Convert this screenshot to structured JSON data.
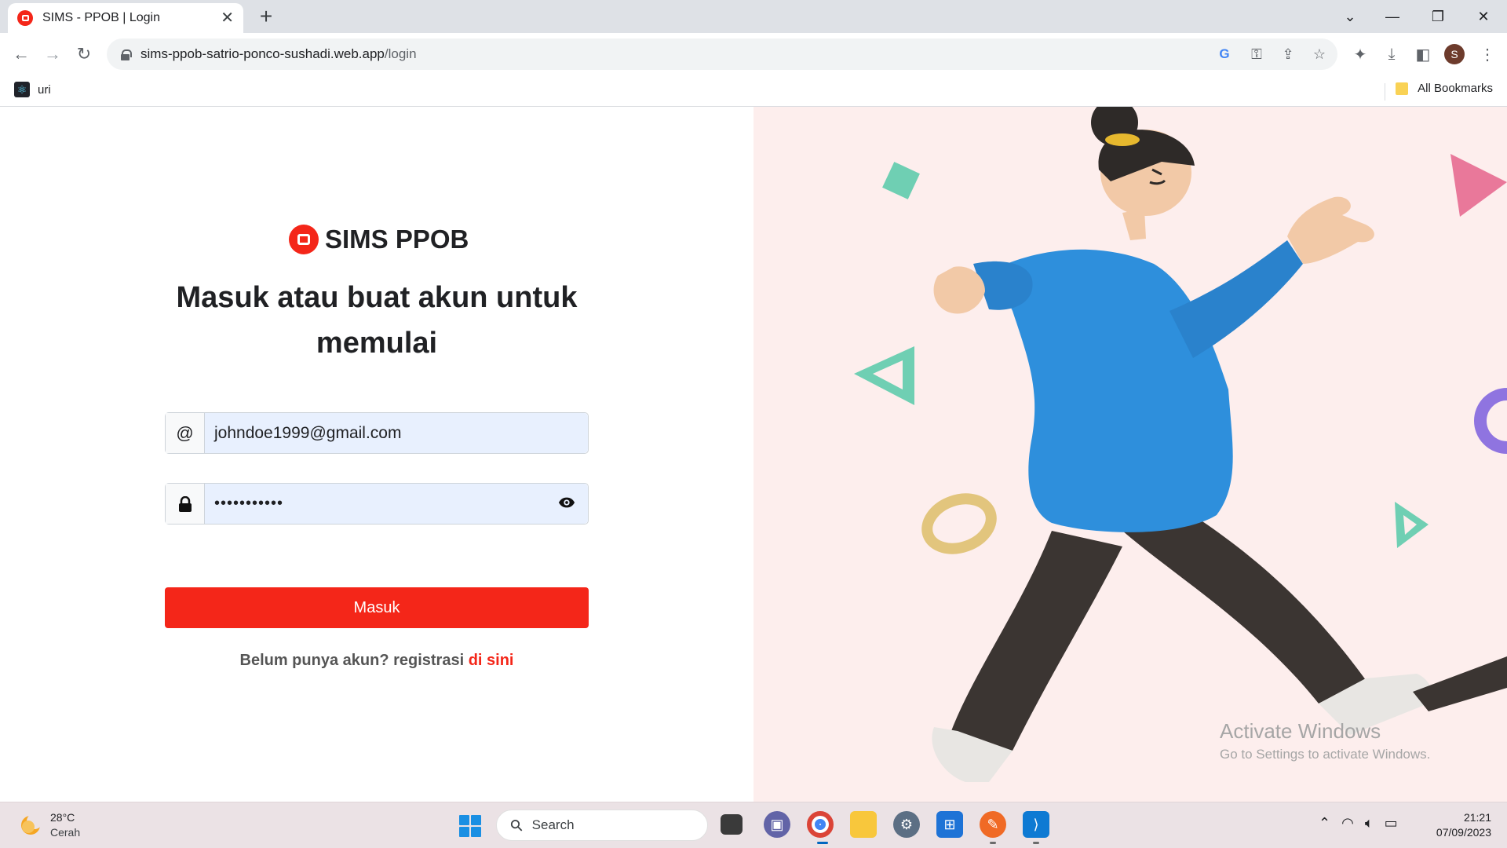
{
  "browser": {
    "tab_title": "SIMS - PPOB | Login",
    "tab_close": "✕",
    "new_tab": "+",
    "url_host": "sims-ppob-satrio-ponco-sushadi.web.app",
    "url_path": "/login",
    "profile_initial": "S",
    "bookmarks": {
      "left_label": "uri",
      "right_label": "All Bookmarks"
    }
  },
  "page": {
    "brand_name": "SIMS PPOB",
    "headline": "Masuk atau buat akun untuk memulai",
    "email_addon": "@",
    "email_value": "johndoe1999@gmail.com",
    "password_value": "•••••••••••",
    "submit_label": "Masuk",
    "register_prompt": "Belum punya akun? registrasi ",
    "register_link": "di sini",
    "accent_color": "#f42619",
    "illustration_bg": "#fdeeed"
  },
  "watermark": {
    "title": "Activate Windows",
    "subtitle": "Go to Settings to activate Windows."
  },
  "taskbar": {
    "weather_temp": "28°C",
    "weather_condition": "Cerah",
    "search_placeholder": "Search",
    "time": "21:21",
    "date": "07/09/2023",
    "apps": [
      "task-view",
      "teams-chat",
      "chrome",
      "file-explorer",
      "settings",
      "microsoft-store",
      "sketch-app",
      "vs-code"
    ]
  }
}
